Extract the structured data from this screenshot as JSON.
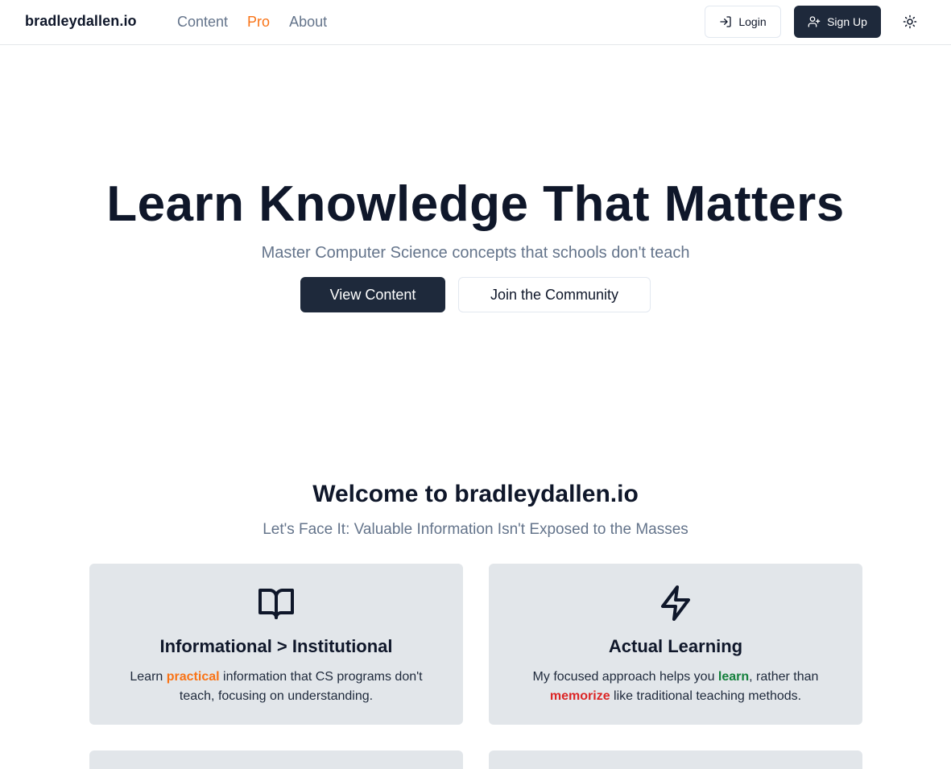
{
  "header": {
    "brand": "bradleydallen.io",
    "nav": [
      {
        "label": "Content",
        "active": false
      },
      {
        "label": "Pro",
        "active": true
      },
      {
        "label": "About",
        "active": false
      }
    ],
    "login_label": "Login",
    "signup_label": "Sign Up",
    "theme_icon": "sun-icon"
  },
  "hero": {
    "title": "Learn Knowledge That Matters",
    "subtitle": "Master Computer Science concepts that schools don't teach",
    "primary_button": "View Content",
    "secondary_button": "Join the Community"
  },
  "welcome": {
    "title": "Welcome to bradleydallen.io",
    "subtitle": "Let's Face It: Valuable Information Isn't Exposed to the Masses"
  },
  "features": [
    {
      "icon": "book-open-icon",
      "title": "Informational > Institutional",
      "text_parts": [
        "Learn ",
        "practical",
        " information that CS programs don't teach, focusing on understanding."
      ]
    },
    {
      "icon": "zap-icon",
      "title": "Actual Learning",
      "text_parts": [
        "My focused approach helps you ",
        "learn",
        ", rather than ",
        "memorize",
        " like traditional teaching methods."
      ]
    }
  ],
  "colors": {
    "accent": "#f97316",
    "primary_dark": "#1e293b",
    "muted_text": "#64748b",
    "card_bg": "#e2e6ea",
    "green": "#15803d",
    "red": "#dc2626"
  }
}
